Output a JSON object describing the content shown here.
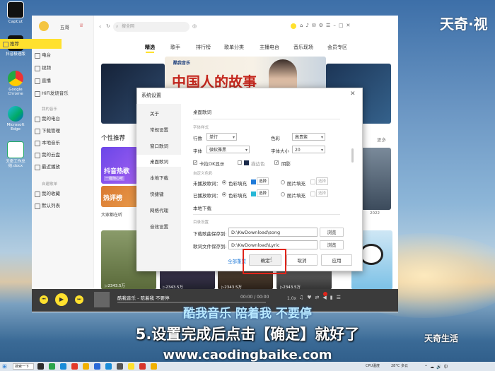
{
  "watermark": {
    "top": "天奇·视",
    "bottom": "天奇生活"
  },
  "desktop_icons": [
    "CapCut",
    "抖音极速版",
    "Google Chrome",
    "Microsoft Edge",
    "天奇工作总结.docx"
  ],
  "app": {
    "user_name": "五哥",
    "search_placeholder": "搜全网",
    "sidebar": {
      "items": [
        {
          "label": "推荐",
          "active": true
        },
        {
          "label": "电台"
        },
        {
          "label": "视频"
        },
        {
          "label": "直播"
        },
        {
          "label": "HiFi发烧音乐"
        }
      ],
      "section_my": "我的音乐",
      "my_items": [
        "我的电台",
        "下载管理",
        "本地音乐",
        "我的云盘",
        "最近播放"
      ],
      "section_playlist": "自建歌单",
      "playlist_items": [
        "我的收藏",
        "默认列表"
      ]
    },
    "tabs": [
      {
        "label": "精选",
        "active": true
      },
      {
        "label": "歌手"
      },
      {
        "label": "排行榜"
      },
      {
        "label": "歌单分类"
      },
      {
        "label": "主播电台"
      },
      {
        "label": "音乐现场"
      },
      {
        "label": "会员专区"
      }
    ],
    "banner": {
      "title": "中国人的故事",
      "brand": "酷我音乐"
    },
    "section_title": "个性推荐",
    "more_label": "更多",
    "cards": [
      {
        "title": "抖音热歌",
        "subtitle": "一键随心听",
        "caption": "大家都在听"
      },
      {
        "title": "热评榜",
        "caption": ""
      }
    ],
    "play_counts": [
      "2343.5万",
      "2343.5万",
      "2343.5万"
    ],
    "date_label": "2022",
    "player": {
      "song": "酷我音乐 - 陪着我 不要停",
      "time": "00:00 / 00:00",
      "speed": "1.0x"
    }
  },
  "dialog": {
    "title": "系统设置",
    "nav": [
      "关于",
      "常规设置",
      "窗口歌词",
      "桌面歌词",
      "本地下载",
      "快捷键",
      "网络代理",
      "音效设置"
    ],
    "active_nav": "桌面歌词",
    "desktop_lyrics": {
      "heading": "桌面歌词",
      "font_style_label": "字体样式",
      "rows_label": "行数",
      "rows_value": "单行",
      "color_label": "色彩",
      "color_value": "高贵紫",
      "font_label": "字体",
      "font_value": "微软雅黑",
      "font_size_label": "字体大小",
      "font_size_value": "20",
      "karaoke_label": "卡拉OK显示",
      "outline_color_label": "描边色",
      "shadow_label": "阴影",
      "custom_colors_label": "自定义色彩",
      "unplayed_label": "未播放歌词：",
      "played_label": "已播放歌词：",
      "color_fill_label": "色彩填充",
      "choose_label": "选择",
      "image_fill_label": "图片填充"
    },
    "local_download": {
      "heading": "本地下载",
      "dir_label": "目录设置",
      "song_dir_label": "下载歌曲保存到:",
      "song_dir_value": "D:\\KwDownload\\song",
      "lyric_dir_label": "歌词文件保存到:",
      "lyric_dir_value": "D:\\KwDownload\\Lyric",
      "browse_label": "浏览"
    },
    "reset_label": "全部重置",
    "ok_label": "确定",
    "cancel_label": "取消",
    "apply_label": "应用"
  },
  "subtitles": {
    "line1": "酷我音乐 陪着我 不要停",
    "line2": "5.设置完成后点击【确定】就好了",
    "url": "www.caodingbaike.com"
  },
  "taskbar": {
    "search_label": "搜索一下",
    "weather": "28°C 多云",
    "stock": "CPU温度"
  },
  "colors": {
    "accent_yellow": "#ffe12e",
    "highlight_red": "#e0251b",
    "subtitle_blue": "#b8e8ff"
  }
}
